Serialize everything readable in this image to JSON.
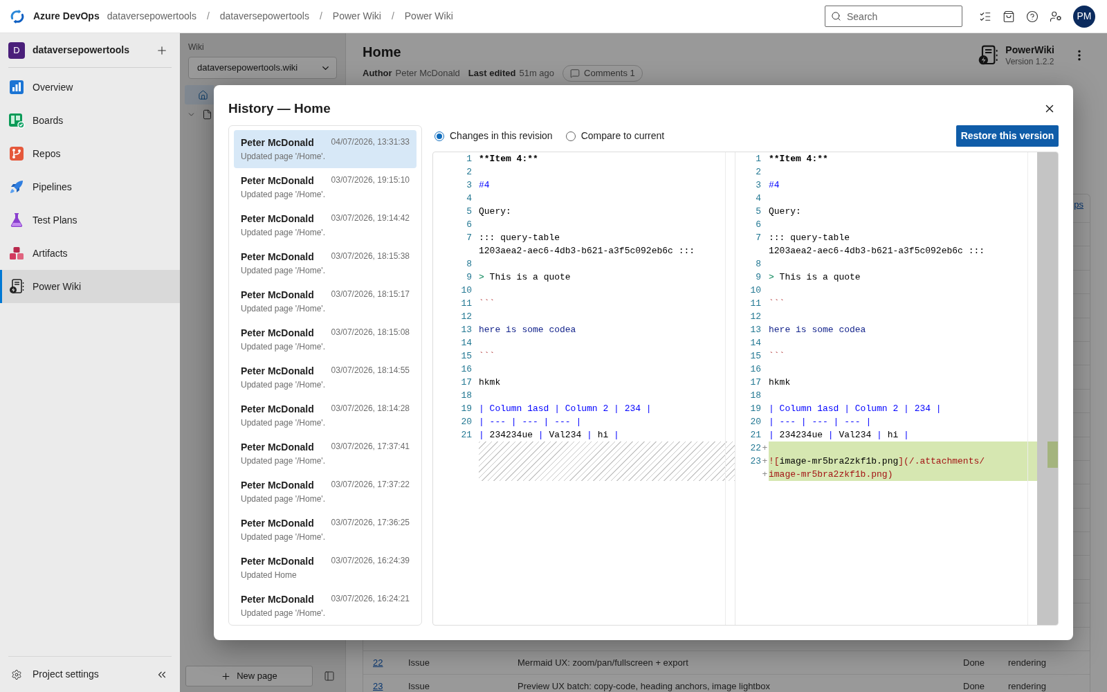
{
  "top_bar": {
    "product": "Azure DevOps",
    "breadcrumbs": [
      {
        "kind": "link",
        "text": "dataversepowertools"
      },
      {
        "kind": "separator",
        "text": "/"
      },
      {
        "kind": "link",
        "text": "dataversepowertools"
      },
      {
        "kind": "separator",
        "text": "/"
      },
      {
        "kind": "link",
        "text": "Power Wiki"
      },
      {
        "kind": "separator",
        "text": "/"
      },
      {
        "kind": "link",
        "text": "Power Wiki"
      }
    ],
    "search": {
      "placeholder": "Search"
    },
    "avatar": "PM"
  },
  "sidebar": {
    "project": {
      "initial": "D",
      "name": "dataversepowertools"
    },
    "items": [
      {
        "label": "Overview",
        "selected": false
      },
      {
        "label": "Boards",
        "selected": false
      },
      {
        "label": "Repos",
        "selected": false
      },
      {
        "label": "Pipelines",
        "selected": false
      },
      {
        "label": "Test Plans",
        "selected": false
      },
      {
        "label": "Artifacts",
        "selected": false
      },
      {
        "label": "Power Wiki",
        "selected": true
      }
    ],
    "footer": "Project settings"
  },
  "wiki_panel": {
    "label": "Wiki",
    "selector": {
      "value": "dataversepowertools.wiki"
    },
    "tree": [
      {
        "selected": true
      },
      {
        "selected": false,
        "expanded": true
      }
    ],
    "new_page_button": "New page"
  },
  "page": {
    "title": "Home",
    "author_label": "Author",
    "author": "Peter McDonald",
    "edited_label": "Last edited",
    "edited": "51m ago",
    "comments_button": "Comments 1",
    "extension": {
      "name": "PowerWiki",
      "version": "Version 1.2.2"
    },
    "table": {
      "header_link": "ps",
      "rows": [
        {
          "id": "22",
          "type": "Issue",
          "title": "Mermaid UX: zoom/pan/fullscreen + export",
          "status": "Done",
          "area": "rendering"
        },
        {
          "id": "23",
          "type": "Issue",
          "title": "Preview UX batch: copy-code, heading anchors, image lightbox",
          "status": "Done",
          "area": "rendering"
        }
      ]
    }
  },
  "dialog": {
    "title": "History — Home",
    "revisions": [
      {
        "author": "Peter McDonald",
        "date": "04/07/2026, 13:31:33",
        "summary": "Updated page '/Home'.",
        "selected": true
      },
      {
        "author": "Peter McDonald",
        "date": "03/07/2026, 19:15:10",
        "summary": "Updated page '/Home'.",
        "selected": false
      },
      {
        "author": "Peter McDonald",
        "date": "03/07/2026, 19:14:42",
        "summary": "Updated page '/Home'.",
        "selected": false
      },
      {
        "author": "Peter McDonald",
        "date": "03/07/2026, 18:15:38",
        "summary": "Updated page '/Home'.",
        "selected": false
      },
      {
        "author": "Peter McDonald",
        "date": "03/07/2026, 18:15:17",
        "summary": "Updated page '/Home'.",
        "selected": false
      },
      {
        "author": "Peter McDonald",
        "date": "03/07/2026, 18:15:08",
        "summary": "Updated page '/Home'.",
        "selected": false
      },
      {
        "author": "Peter McDonald",
        "date": "03/07/2026, 18:14:55",
        "summary": "Updated page '/Home'.",
        "selected": false
      },
      {
        "author": "Peter McDonald",
        "date": "03/07/2026, 18:14:28",
        "summary": "Updated page '/Home'.",
        "selected": false
      },
      {
        "author": "Peter McDonald",
        "date": "03/07/2026, 17:37:41",
        "summary": "Updated page '/Home'.",
        "selected": false
      },
      {
        "author": "Peter McDonald",
        "date": "03/07/2026, 17:37:22",
        "summary": "Updated page '/Home'.",
        "selected": false
      },
      {
        "author": "Peter McDonald",
        "date": "03/07/2026, 17:36:25",
        "summary": "Updated page '/Home'.",
        "selected": false
      },
      {
        "author": "Peter McDonald",
        "date": "03/07/2026, 16:24:39",
        "summary": "Updated Home",
        "selected": false
      },
      {
        "author": "Peter McDonald",
        "date": "03/07/2026, 16:24:21",
        "summary": "Updated page '/Home'.",
        "selected": false
      }
    ],
    "modes": [
      {
        "label": "Changes in this revision",
        "selected": true
      },
      {
        "label": "Compare to current",
        "selected": false
      }
    ],
    "restore_button": "Restore this version",
    "diff": {
      "left": [
        {
          "number": "1",
          "kind": "normal",
          "segments": [
            {
              "text": "**Item 4:**",
              "kind": "bold"
            }
          ]
        },
        {
          "number": "2",
          "kind": "normal"
        },
        {
          "number": "3",
          "kind": "normal",
          "segments": [
            {
              "text": "#4",
              "kind": "keyword"
            }
          ]
        },
        {
          "number": "4",
          "kind": "normal"
        },
        {
          "number": "5",
          "kind": "normal",
          "segments": [
            {
              "text": "Query:",
              "kind": "plain"
            }
          ]
        },
        {
          "number": "6",
          "kind": "normal"
        },
        {
          "number": "7",
          "kind": "normal",
          "segments": [
            {
              "text": "::: query-table",
              "kind": "plain"
            }
          ]
        },
        {
          "kind": "normal",
          "segments": [
            {
              "text": "1203aea2-aec6-4db3-b621-a3f5c092eb6c :::",
              "kind": "plain"
            }
          ]
        },
        {
          "number": "8",
          "kind": "normal"
        },
        {
          "number": "9",
          "kind": "normal",
          "segments": [
            {
              "text": ">",
              "kind": "quote"
            },
            {
              "text": " This is a quote",
              "kind": "plain"
            }
          ]
        },
        {
          "number": "10",
          "kind": "normal"
        },
        {
          "number": "11",
          "kind": "normal",
          "segments": [
            {
              "text": "```",
              "kind": "string"
            }
          ]
        },
        {
          "number": "12",
          "kind": "normal"
        },
        {
          "number": "13",
          "kind": "normal",
          "segments": [
            {
              "text": "here is some codea",
              "kind": "code"
            }
          ]
        },
        {
          "number": "14",
          "kind": "normal"
        },
        {
          "number": "15",
          "kind": "normal",
          "segments": [
            {
              "text": "```",
              "kind": "string"
            }
          ]
        },
        {
          "number": "16",
          "kind": "normal"
        },
        {
          "number": "17",
          "kind": "normal",
          "segments": [
            {
              "text": "hkmk",
              "kind": "plain"
            }
          ]
        },
        {
          "number": "18",
          "kind": "normal"
        },
        {
          "number": "19",
          "kind": "normal",
          "segments": [
            {
              "text": "| Column 1asd | Column 2 | 234 |",
              "kind": "keyword"
            }
          ]
        },
        {
          "number": "20",
          "kind": "normal",
          "segments": [
            {
              "text": "| --- | --- | --- |",
              "kind": "keyword"
            }
          ]
        },
        {
          "number": "21",
          "kind": "normal",
          "segments": [
            {
              "text": "| ",
              "kind": "keyword"
            },
            {
              "text": "234234ue",
              "kind": "plain"
            },
            {
              "text": " | ",
              "kind": "keyword"
            },
            {
              "text": "Val234",
              "kind": "plain"
            },
            {
              "text": " | ",
              "kind": "keyword"
            },
            {
              "text": "hi",
              "kind": "plain"
            },
            {
              "text": " |",
              "kind": "keyword"
            }
          ]
        },
        {
          "kind": "filler"
        },
        {
          "kind": "filler"
        },
        {
          "kind": "filler"
        }
      ],
      "right": [
        {
          "number": "1",
          "kind": "normal",
          "segments": [
            {
              "text": "**Item 4:**",
              "kind": "bold"
            }
          ]
        },
        {
          "number": "2",
          "kind": "normal"
        },
        {
          "number": "3",
          "kind": "normal",
          "segments": [
            {
              "text": "#4",
              "kind": "keyword"
            }
          ]
        },
        {
          "number": "4",
          "kind": "normal"
        },
        {
          "number": "5",
          "kind": "normal",
          "segments": [
            {
              "text": "Query:",
              "kind": "plain"
            }
          ]
        },
        {
          "number": "6",
          "kind": "normal"
        },
        {
          "number": "7",
          "kind": "normal",
          "segments": [
            {
              "text": "::: query-table",
              "kind": "plain"
            }
          ]
        },
        {
          "kind": "normal",
          "segments": [
            {
              "text": "1203aea2-aec6-4db3-b621-a3f5c092eb6c :::",
              "kind": "plain"
            }
          ]
        },
        {
          "number": "8",
          "kind": "normal"
        },
        {
          "number": "9",
          "kind": "normal",
          "segments": [
            {
              "text": ">",
              "kind": "quote"
            },
            {
              "text": " This is a quote",
              "kind": "plain"
            }
          ]
        },
        {
          "number": "10",
          "kind": "normal"
        },
        {
          "number": "11",
          "kind": "normal",
          "segments": [
            {
              "text": "```",
              "kind": "string"
            }
          ]
        },
        {
          "number": "12",
          "kind": "normal"
        },
        {
          "number": "13",
          "kind": "normal",
          "segments": [
            {
              "text": "here is some codea",
              "kind": "code"
            }
          ]
        },
        {
          "number": "14",
          "kind": "normal"
        },
        {
          "number": "15",
          "kind": "normal",
          "segments": [
            {
              "text": "```",
              "kind": "string"
            }
          ]
        },
        {
          "number": "16",
          "kind": "normal"
        },
        {
          "number": "17",
          "kind": "normal",
          "segments": [
            {
              "text": "hkmk",
              "kind": "plain"
            }
          ]
        },
        {
          "number": "18",
          "kind": "normal"
        },
        {
          "number": "19",
          "kind": "normal",
          "segments": [
            {
              "text": "| Column 1asd | Column 2 | 234 |",
              "kind": "keyword"
            }
          ]
        },
        {
          "number": "20",
          "kind": "normal",
          "segments": [
            {
              "text": "| --- | --- | --- |",
              "kind": "keyword"
            }
          ]
        },
        {
          "number": "21",
          "kind": "normal",
          "segments": [
            {
              "text": "| ",
              "kind": "keyword"
            },
            {
              "text": "234234ue",
              "kind": "plain"
            },
            {
              "text": " | ",
              "kind": "keyword"
            },
            {
              "text": "Val234",
              "kind": "plain"
            },
            {
              "text": " | ",
              "kind": "keyword"
            },
            {
              "text": "hi",
              "kind": "plain"
            },
            {
              "text": " |",
              "kind": "keyword"
            }
          ]
        },
        {
          "number": "22",
          "kind": "added",
          "marker": "+"
        },
        {
          "number": "23",
          "kind": "added",
          "marker": "+",
          "segments": [
            {
              "text": "![",
              "kind": "string"
            },
            {
              "text": "image-mr5bra2zkf1b.png",
              "kind": "plain"
            },
            {
              "text": "](/.attachments/",
              "kind": "string"
            }
          ]
        },
        {
          "kind": "added",
          "marker": "+",
          "segments": [
            {
              "text": "image-mr5bra2zkf1b.png)",
              "kind": "string"
            }
          ]
        }
      ]
    }
  }
}
